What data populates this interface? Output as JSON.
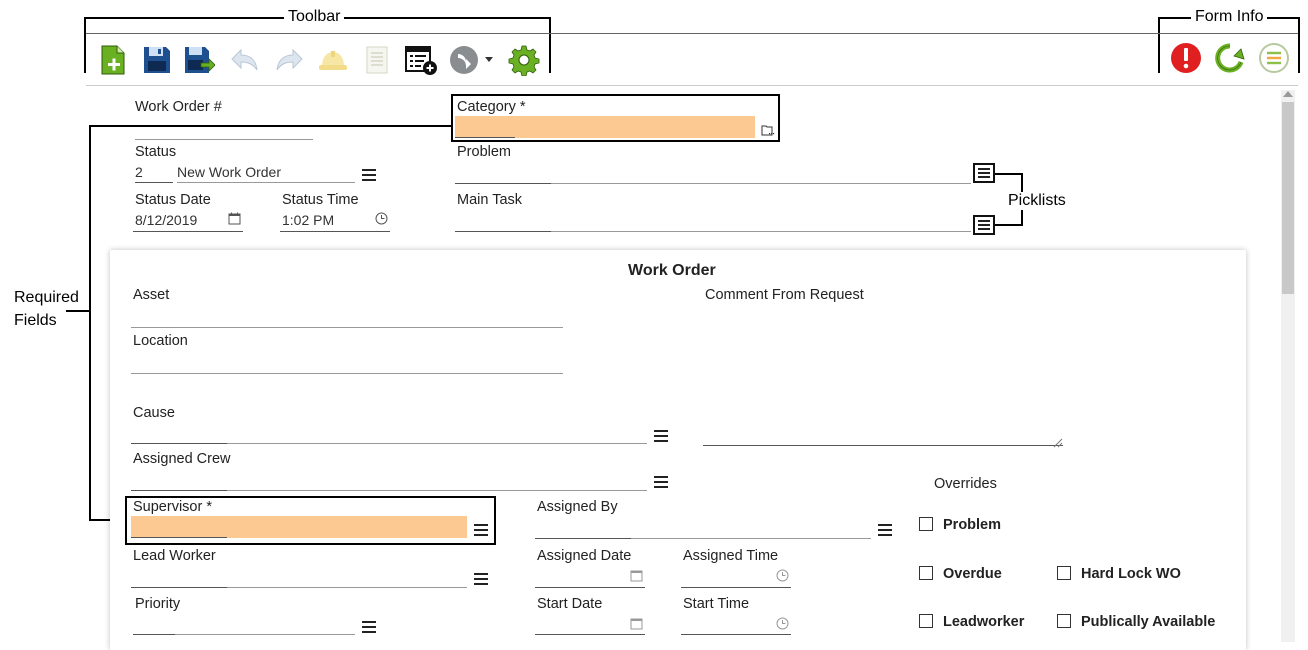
{
  "annotations": {
    "toolbar": "Toolbar",
    "form_info": "Form Info",
    "picklists": "Picklists",
    "required_fields_line1": "Required",
    "required_fields_line2": "Fields"
  },
  "toolbar_icons": [
    "new-record-icon",
    "save-icon",
    "save-and-exit-icon",
    "undo-icon",
    "redo-icon",
    "hardhat-icon",
    "document-icon",
    "add-list-icon",
    "arrow-dropdown-icon",
    "settings-gear-icon"
  ],
  "form_info_icons": [
    "alert-icon",
    "refresh-icon",
    "list-icon"
  ],
  "colors": {
    "required_bg": "#fcc993",
    "alert": "#e02020",
    "refresh": "#6ab023",
    "gear": "#6ab023",
    "save_blue": "#1e4f8f"
  },
  "header": {
    "work_order_label": "Work Order #",
    "category_label": "Category *",
    "status_label": "Status",
    "status_code": "2",
    "status_text": "New Work Order",
    "problem_label": "Problem",
    "status_date_label": "Status Date",
    "status_date_value": "8/12/2019",
    "status_time_label": "Status Time",
    "status_time_value": "1:02 PM",
    "main_task_label": "Main Task"
  },
  "panel": {
    "title": "Work Order",
    "asset_label": "Asset",
    "comment_label": "Comment From Request",
    "location_label": "Location",
    "cause_label": "Cause",
    "assigned_crew_label": "Assigned Crew",
    "overrides_label": "Overrides",
    "supervisor_label": "Supervisor *",
    "assigned_by_label": "Assigned By",
    "lead_worker_label": "Lead Worker",
    "assigned_date_label": "Assigned Date",
    "assigned_time_label": "Assigned Time",
    "priority_label": "Priority",
    "start_date_label": "Start Date",
    "start_time_label": "Start Time",
    "checkboxes": {
      "problem": "Problem",
      "overdue": "Overdue",
      "hard_lock": "Hard Lock WO",
      "leadworker": "Leadworker",
      "publically_available": "Publically Available"
    }
  }
}
